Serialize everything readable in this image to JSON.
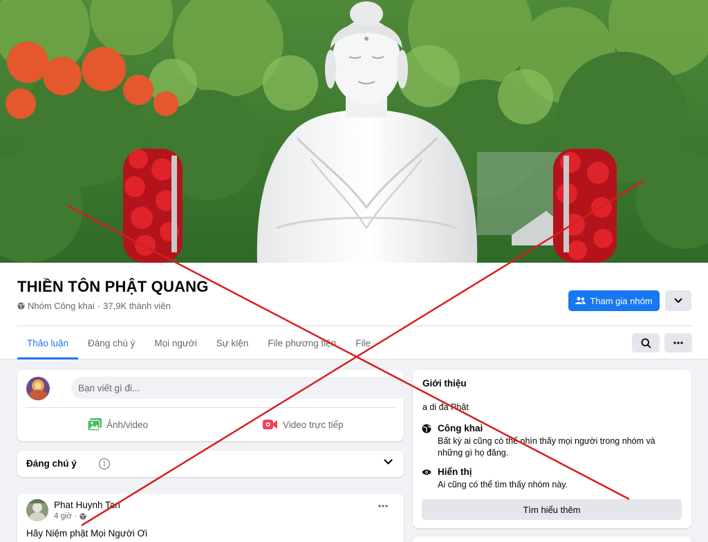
{
  "group": {
    "name": "THIỀN TÔN PHẬT QUANG",
    "privacy": "Nhóm Công khai",
    "members": "37,9K thành viên",
    "meta_separator": " · "
  },
  "actions": {
    "join_label": "Tham gia nhóm",
    "join_icon": "people-icon",
    "more_icon": "chevron-down-icon"
  },
  "tabs": [
    {
      "label": "Thảo luận",
      "active": true
    },
    {
      "label": "Đáng chú ý",
      "active": false
    },
    {
      "label": "Mọi người",
      "active": false
    },
    {
      "label": "Sự kiện",
      "active": false
    },
    {
      "label": "File phương tiện",
      "active": false
    },
    {
      "label": "File",
      "active": false
    }
  ],
  "composer": {
    "placeholder": "Bạn viết gì đi...",
    "photo_label": "Ảnh/video",
    "live_label": "Video trực tiếp"
  },
  "featured": {
    "label": "Đáng chú ý",
    "info_glyph": "i"
  },
  "post": {
    "author": "Phat Huynh Tan",
    "time": "4 giờ · ",
    "text": "Hãy Niệm phật Mọi Người Ơi"
  },
  "about": {
    "title": "Giới thiệu",
    "description": "a di đà Phật",
    "public_heading": "Công khai",
    "public_text": "Bất kỳ ai cũng có thể nhìn thấy mọi người trong nhóm và những gì họ đăng.",
    "visible_heading": "Hiển thị",
    "visible_text": "Ai cũng có thể tìm thấy nhóm này.",
    "learn_more": "Tìm hiểu thêm"
  },
  "colors": {
    "accent": "#1877f2",
    "cross": "#d91d1d",
    "background": "#f0f2f5"
  }
}
